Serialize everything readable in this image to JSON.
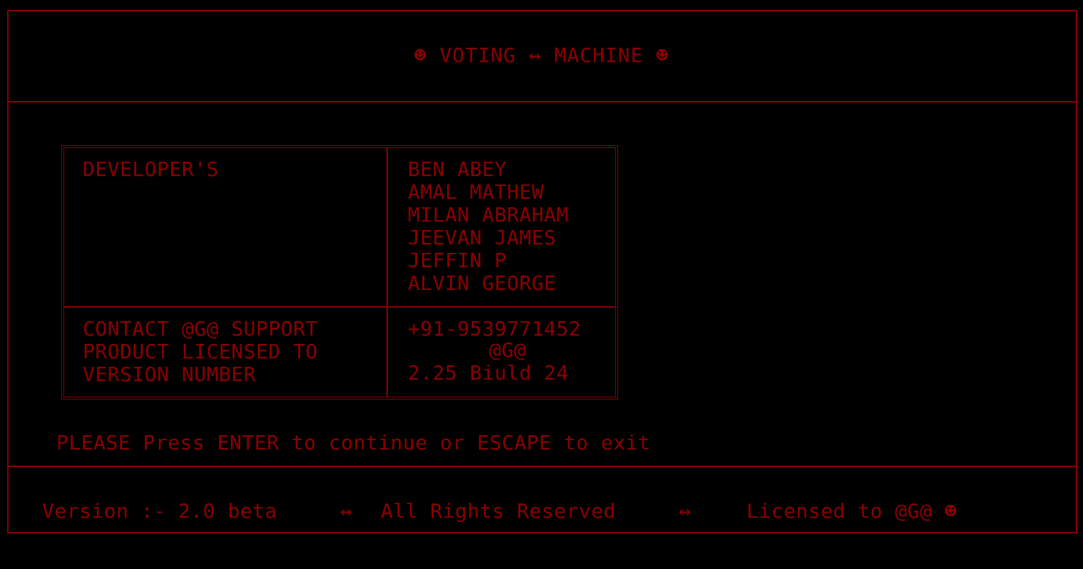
{
  "header": {
    "title": "☻ VOTING ↔ MACHINE ☻"
  },
  "developers": {
    "label": "DEVELOPER'S",
    "names": [
      "BEN ABEY",
      "AMAL MATHEW",
      "MILAN ABRAHAM",
      "JEEVAN JAMES",
      "JEFFIN P",
      "ALVIN GEORGE"
    ]
  },
  "info": {
    "contact_label": "CONTACT @G@ SUPPORT",
    "license_label": "PRODUCT LICENSED TO",
    "version_label": "VERSION NUMBER",
    "contact_value": "+91-9539771452",
    "license_value": "@G@",
    "version_value": "2.25 Biuld 24"
  },
  "prompt": "PLEASE Press ENTER to continue or ESCAPE to exit",
  "footer": {
    "version": "Version :- 2.0 beta",
    "sep1": "↔",
    "rights": "All Rights Reserved",
    "sep2": "↔",
    "licensed": "Licensed to @G@ ☻"
  },
  "colors": {
    "foreground": "#8b0000",
    "background": "#000000"
  }
}
